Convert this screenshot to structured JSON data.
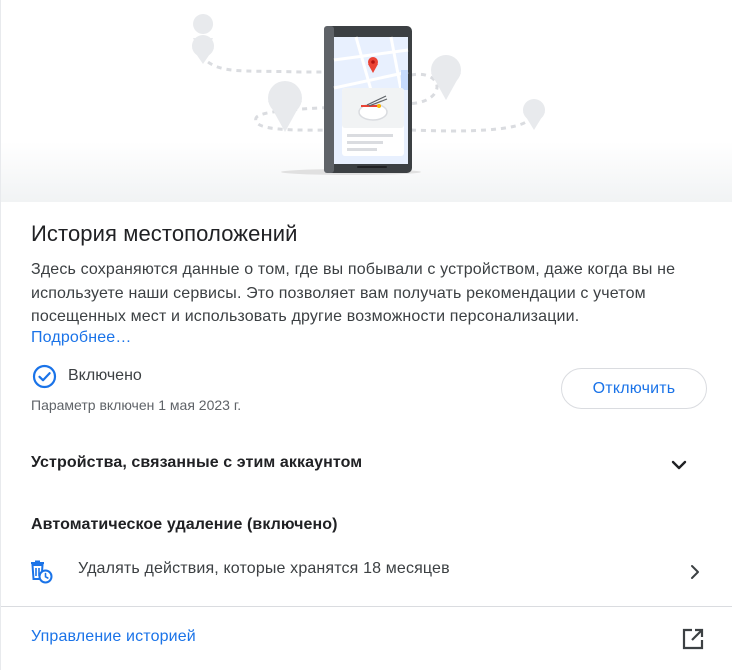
{
  "location_history": {
    "title": "История местоположений",
    "description": "Здесь сохраняются данные о том, где вы побывали с устройством, даже когда вы не используете наши сервисы. Это позволяет вам получать рекомендации с учетом посещенных мест и использовать другие возможности персонализации.",
    "more_link": "Подробнее…"
  },
  "status": {
    "label": "Включено",
    "enabled_date": "Параметр включен 1 мая 2023 г.",
    "disable_button": "Отключить"
  },
  "devices": {
    "label": "Устройства, связанные с этим аккаунтом"
  },
  "auto_delete": {
    "title": "Автоматическое удаление (включено)",
    "item_label": "Удалять действия, которые хранятся 18 месяцев"
  },
  "manage": {
    "label": "Управление историей"
  },
  "icons": {
    "status": "check-circle-icon",
    "devices_expand": "chevron-down-icon",
    "auto_delete": "auto-delete-icon",
    "auto_delete_open": "chevron-right-icon",
    "manage_open": "open-in-new-icon"
  },
  "colors": {
    "accent": "#1a73e8",
    "status_icon": "#1a73e8",
    "map_pin": "#ea4335"
  }
}
